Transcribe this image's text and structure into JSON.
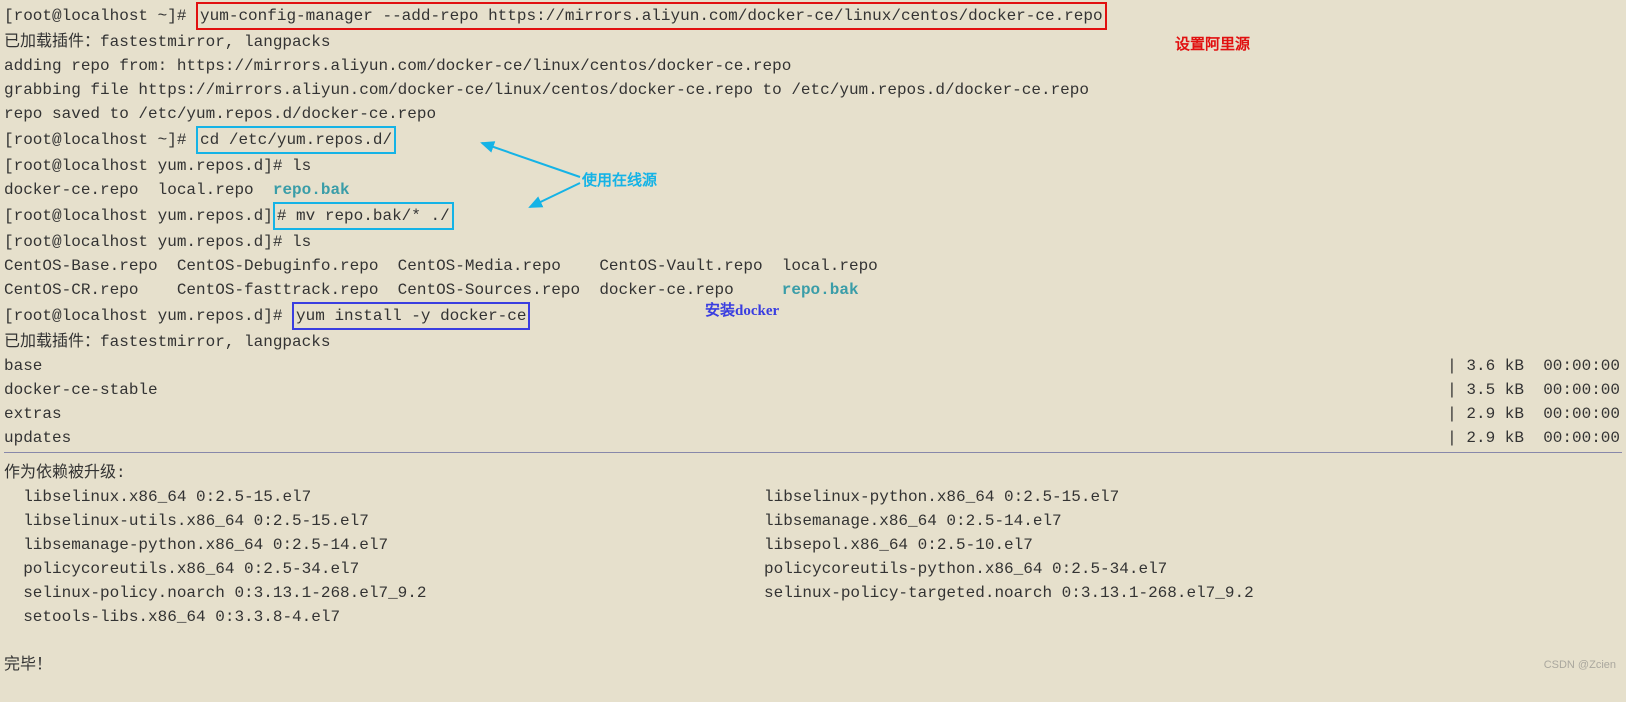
{
  "prompt_home": "[root@localhost ~]# ",
  "prompt_repos": "[root@localhost yum.repos.d]# ",
  "cmd_add_repo": "yum-config-manager --add-repo https://mirrors.aliyun.com/docker-ce/linux/centos/docker-ce.repo",
  "out_plugins": "已加载插件：fastestmirror, langpacks",
  "out_adding": "adding repo from: https://mirrors.aliyun.com/docker-ce/linux/centos/docker-ce.repo",
  "out_grabbing": "grabbing file https://mirrors.aliyun.com/docker-ce/linux/centos/docker-ce.repo to /etc/yum.repos.d/docker-ce.repo",
  "out_saved": "repo saved to /etc/yum.repos.d/docker-ce.repo",
  "cmd_cd": "cd /etc/yum.repos.d/",
  "cmd_ls": "ls",
  "ls1_a": "docker-ce.repo  local.repo  ",
  "ls1_b": "repo.bak",
  "cmd_mv_pre": "# ",
  "cmd_mv": "mv repo.bak/* ./",
  "ls2_row1_c1": "CentOS-Base.repo  ",
  "ls2_row1_c2": "CentOS-Debuginfo.repo  ",
  "ls2_row1_c3": "CentOS-Media.repo    ",
  "ls2_row1_c4": "CentOS-Vault.repo  ",
  "ls2_row1_c5": "local.repo",
  "ls2_row2_c1": "CentOS-CR.repo    ",
  "ls2_row2_c2": "CentOS-fasttrack.repo  ",
  "ls2_row2_c3": "CentOS-Sources.repo  ",
  "ls2_row2_c4": "docker-ce.repo     ",
  "ls2_row2_c5": "repo.bak",
  "cmd_install": "yum install -y docker-ce",
  "repos": [
    {
      "name": "base",
      "size": "3.6 kB",
      "time": "00:00:00"
    },
    {
      "name": "docker-ce-stable",
      "size": "3.5 kB",
      "time": "00:00:00"
    },
    {
      "name": "extras",
      "size": "2.9 kB",
      "time": "00:00:00"
    },
    {
      "name": "updates",
      "size": "2.9 kB",
      "time": "00:00:00"
    }
  ],
  "deps_header": "作为依赖被升级:",
  "deps_left": [
    "libselinux.x86_64 0:2.5-15.el7",
    "libselinux-utils.x86_64 0:2.5-15.el7",
    "libsemanage-python.x86_64 0:2.5-14.el7",
    "policycoreutils.x86_64 0:2.5-34.el7",
    "selinux-policy.noarch 0:3.13.1-268.el7_9.2",
    "setools-libs.x86_64 0:3.3.8-4.el7"
  ],
  "deps_right": [
    "libselinux-python.x86_64 0:2.5-15.el7",
    "libsemanage.x86_64 0:2.5-14.el7",
    "libsepol.x86_64 0:2.5-10.el7",
    "policycoreutils-python.x86_64 0:2.5-34.el7",
    "selinux-policy-targeted.noarch 0:3.13.1-268.el7_9.2"
  ],
  "done": "完毕！",
  "annot_red": "设置阿里源",
  "annot_cyan": "使用在线源",
  "annot_blue": "安装docker",
  "watermark": "CSDN @Zcien"
}
